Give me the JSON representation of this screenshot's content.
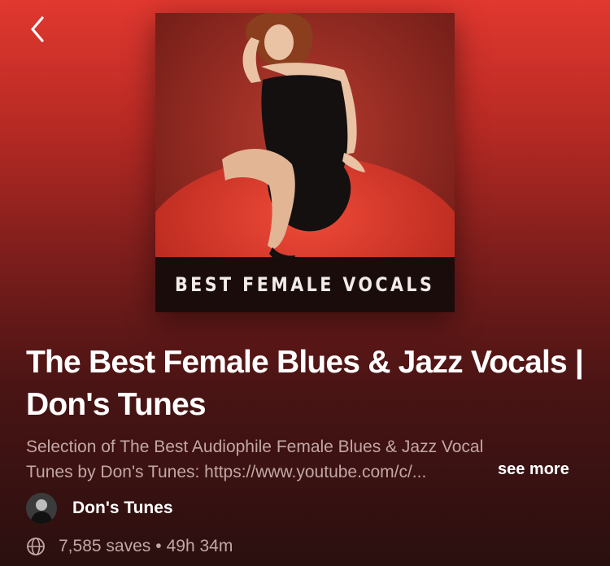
{
  "header": {
    "back_icon": "chevron-left-icon"
  },
  "playlist": {
    "cover_caption": "BEST FEMALE VOCALS",
    "title": "The Best Female Blues & Jazz Vocals | Don's Tunes",
    "description_line_1": "Selection of The Best Audiophile Female Blues & Jazz Vocal",
    "description_line_2": "Tunes by Don's Tunes: https://www.youtube.com/c/...",
    "see_more_label": "see more",
    "owner_name": "Don's Tunes",
    "saves": "7,585 saves",
    "separator": "•",
    "duration": "49h 34m",
    "visibility_icon": "globe-icon"
  },
  "colors": {
    "gradient_top": "#e1382f",
    "gradient_bottom": "#2a0f0f",
    "secondary_text": "#c2a7a6"
  }
}
